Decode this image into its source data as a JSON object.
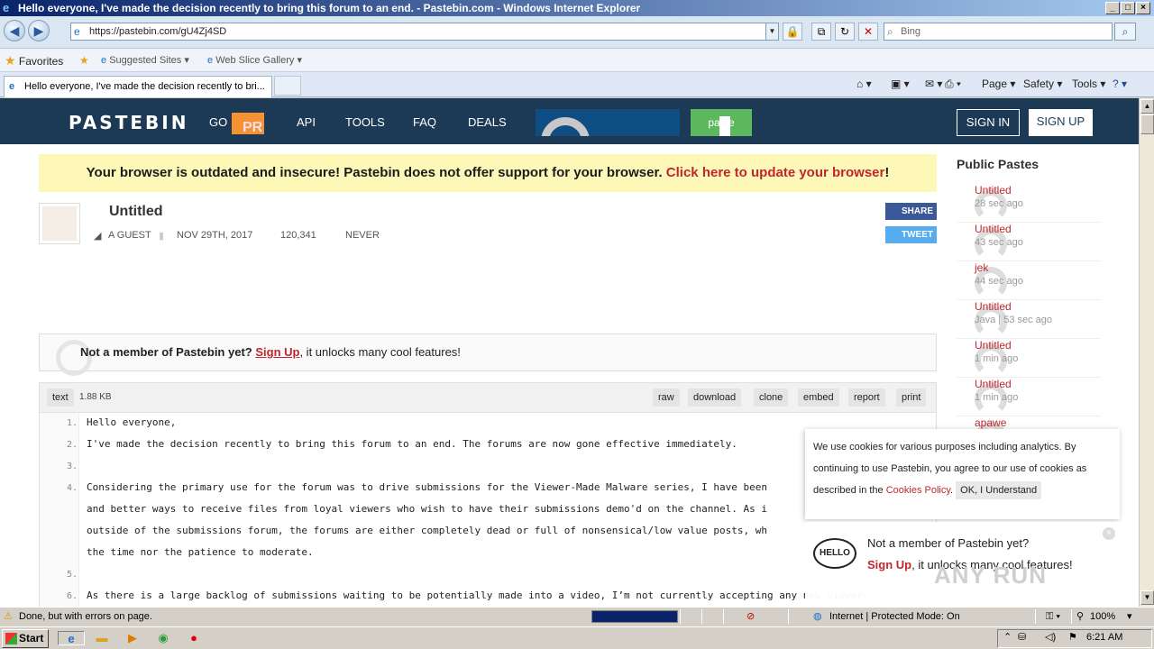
{
  "window": {
    "title": "Hello everyone, I've made the decision recently to bring this forum to an end. - Pastebin.com - Windows Internet Explorer"
  },
  "addressbar": {
    "url": "https://pastebin.com/gU4Zj4SD",
    "search_placeholder": "Bing"
  },
  "favorites_bar": {
    "favorites_label": "Favorites",
    "suggested_sites": "Suggested Sites",
    "web_slice_gallery": "Web Slice Gallery"
  },
  "tab": {
    "title": "Hello everyone, I've made the decision recently to bri..."
  },
  "command_bar": {
    "page": "Page",
    "safety": "Safety",
    "tools": "Tools"
  },
  "site_header": {
    "logo": "PASTEBIN",
    "nav": [
      "GO",
      "API",
      "TOOLS",
      "FAQ",
      "DEALS"
    ],
    "paste_button": "paste",
    "sign_in": "SIGN IN",
    "sign_up": "SIGN UP"
  },
  "warning": {
    "text": "Your browser is outdated and insecure! Pastebin does not offer support for your browser. ",
    "link": "Click here to update your browser",
    "end": "!"
  },
  "paste": {
    "title": "Untitled",
    "author": "A GUEST",
    "date": "NOV 29TH, 2017",
    "views": "120,341",
    "expires": "NEVER",
    "share": "SHARE",
    "tweet": "TWEET"
  },
  "notice": {
    "prompt": "Not a member of Pastebin yet?",
    "signup": "Sign Up",
    "rest": ", it unlocks many cool features!"
  },
  "code_toolbar": {
    "syntax": "text",
    "size": "1.88 KB",
    "actions": [
      "raw",
      "download",
      "clone",
      "embed",
      "report",
      "print"
    ]
  },
  "code_lines": [
    {
      "n": "1.",
      "text": "Hello everyone,"
    },
    {
      "n": "2.",
      "text": "I've made the decision recently to bring this forum to an end. The forums are now gone effective immediately."
    },
    {
      "n": "3.",
      "text": ""
    },
    {
      "n": "4.",
      "text": "Considering the primary use for the forum was to drive submissions for the Viewer-Made Malware series, I have been"
    },
    {
      "n": "",
      "text": "and better ways to receive files from loyal viewers who wish to have their submissions demo'd on the channel. As i"
    },
    {
      "n": "",
      "text": "outside of the submissions forum, the forums are either completely dead or full of nonsensical/low value posts, wh"
    },
    {
      "n": "",
      "text": "the time nor the patience to moderate."
    },
    {
      "n": "5.",
      "text": ""
    },
    {
      "n": "6.",
      "text": "As there is a large backlog of submissions waiting to be potentially made into a video, I’m not currently accepting any new viewer-"
    }
  ],
  "sidebar": {
    "title": "Public Pastes",
    "items": [
      {
        "title": "Untitled",
        "sub": "28 sec ago"
      },
      {
        "title": "Untitled",
        "sub": "43 sec ago"
      },
      {
        "title": "jek",
        "sub": "44 sec ago"
      },
      {
        "title": "Untitled",
        "sub": "Java | 53 sec ago"
      },
      {
        "title": "Untitled",
        "sub": "1 min ago"
      },
      {
        "title": "Untitled",
        "sub": "1 min ago"
      },
      {
        "title": "apawe",
        "sub": ""
      }
    ]
  },
  "cookie_banner": {
    "text": "We use cookies for various purposes including analytics. By continuing to use Pastebin, you agree to our use of cookies as described in the ",
    "link": "Cookies Policy",
    "end": ".",
    "ok": "OK, I Understand"
  },
  "hello_popup": {
    "badge": "HELLO",
    "question": "Not a member of Pastebin yet?",
    "signup": "Sign Up",
    "rest": ", it unlocks many cool features!",
    "watermark": "ANY RUN"
  },
  "statusbar": {
    "message": "Done, but with errors on page.",
    "zone": "Internet | Protected Mode: On",
    "zoom": "100%"
  },
  "taskbar": {
    "start": "Start",
    "clock": "6:21 AM"
  },
  "colors": {
    "header_bg": "#1c3a55",
    "accent_red": "#c0272d",
    "warning_bg": "#fdf8b8",
    "paste_green": "#5cb85c",
    "facebook": "#3b5998",
    "twitter": "#55acee"
  }
}
